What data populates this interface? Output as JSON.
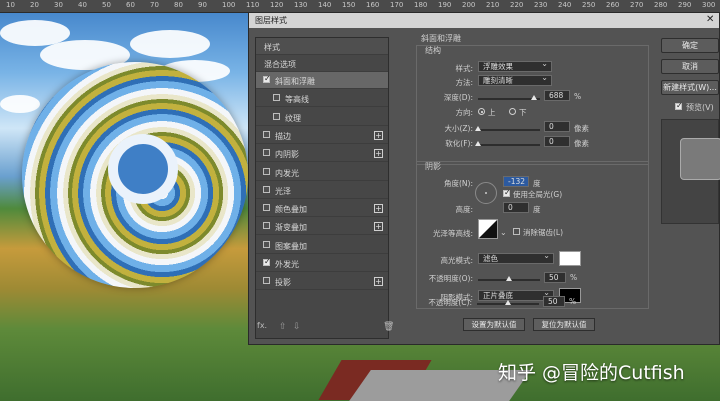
{
  "ruler": {
    "numbers": [
      "10",
      "20",
      "30",
      "40",
      "50",
      "60",
      "70",
      "80",
      "90",
      "100",
      "110",
      "120",
      "130",
      "140",
      "150",
      "160",
      "170",
      "180",
      "190",
      "200",
      "210",
      "220",
      "230",
      "240",
      "250",
      "260",
      "270",
      "280",
      "290",
      "300"
    ]
  },
  "watermark": "知乎 @冒险的Cutfish",
  "dialog": {
    "title": "图层样式",
    "style_list": {
      "header": "样式",
      "blend_options": "混合选项",
      "items": [
        {
          "label": "斜面和浮雕",
          "checked": true,
          "selected": true,
          "plus": false
        },
        {
          "label": "等高线",
          "checked": false,
          "sub": true,
          "plus": false
        },
        {
          "label": "纹理",
          "checked": false,
          "sub": true,
          "plus": false
        },
        {
          "label": "描边",
          "checked": false,
          "plus": true
        },
        {
          "label": "内阴影",
          "checked": false,
          "plus": true
        },
        {
          "label": "内发光",
          "checked": false,
          "plus": false
        },
        {
          "label": "光泽",
          "checked": false,
          "plus": false
        },
        {
          "label": "颜色叠加",
          "checked": false,
          "plus": true
        },
        {
          "label": "渐变叠加",
          "checked": false,
          "plus": true
        },
        {
          "label": "图案叠加",
          "checked": false,
          "plus": false
        },
        {
          "label": "外发光",
          "checked": true,
          "plus": false
        },
        {
          "label": "投影",
          "checked": false,
          "plus": true
        }
      ],
      "footer_fx": "fx."
    },
    "bevel": {
      "section_title": "斜面和浮雕",
      "structure_title": "结构",
      "style_label": "样式:",
      "style_value": "浮雕效果",
      "technique_label": "方法:",
      "technique_value": "雕刻清晰",
      "depth_label": "深度(D):",
      "depth_value": "688",
      "depth_unit": "%",
      "depth_fraction": 0.9,
      "direction_label": "方向:",
      "direction_up": "上",
      "direction_down": "下",
      "size_label": "大小(Z):",
      "size_value": "0",
      "size_unit": "像素",
      "size_fraction": 0,
      "soften_label": "软化(F):",
      "soften_value": "0",
      "soften_unit": "像素",
      "soften_fraction": 0
    },
    "shading": {
      "title": "阴影",
      "angle_label": "角度(N):",
      "angle_value": "-132",
      "angle_unit": "度",
      "global_light": "使用全局光(G)",
      "altitude_label": "高度:",
      "altitude_value": "0",
      "altitude_unit": "度",
      "gloss_label": "光泽等高线:",
      "antialias": "消除锯齿(L)",
      "highlight_label": "高光模式:",
      "highlight_value": "滤色",
      "highlight_color": "#ffffff",
      "hl_opacity_label": "不透明度(O):",
      "hl_opacity_value": "50",
      "hl_opacity_unit": "%",
      "hl_opacity_fraction": 0.5,
      "shadow_label": "阴影模式:",
      "shadow_value": "正片叠底",
      "shadow_color": "#000000",
      "sh_opacity_label": "不透明度(C):",
      "sh_opacity_value": "50",
      "sh_opacity_unit": "%",
      "sh_opacity_fraction": 0.5
    },
    "buttons": {
      "make_default": "设置为默认值",
      "reset_default": "复位为默认值",
      "ok": "确定",
      "cancel": "取消",
      "new_style": "新建样式(W)...",
      "preview": "预览(V)"
    }
  }
}
